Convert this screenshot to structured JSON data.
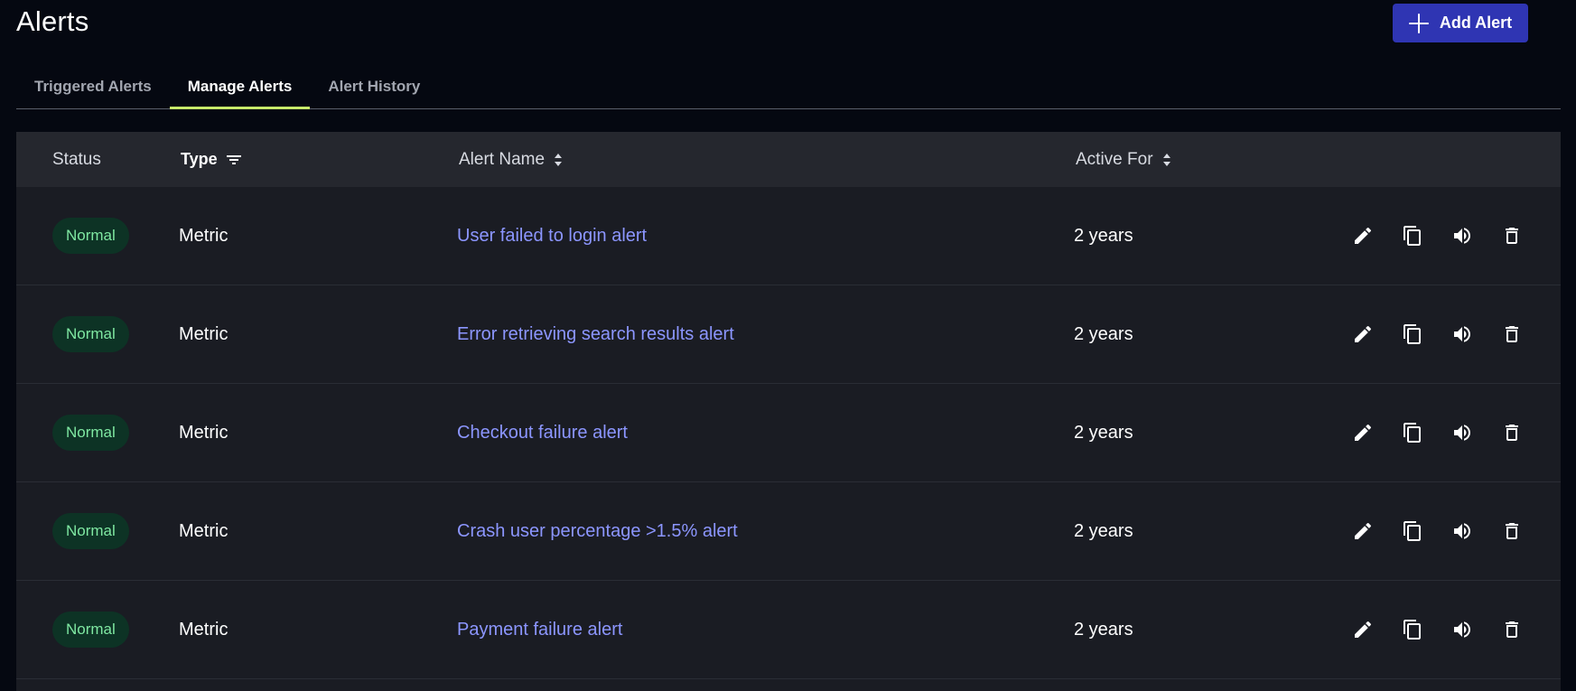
{
  "page": {
    "title": "Alerts"
  },
  "header": {
    "add_button_label": "Add Alert"
  },
  "tabs": [
    {
      "label": "Triggered Alerts",
      "active": false
    },
    {
      "label": "Manage Alerts",
      "active": true
    },
    {
      "label": "Alert History",
      "active": false
    }
  ],
  "table": {
    "columns": {
      "status": "Status",
      "type": "Type",
      "alert_name": "Alert Name",
      "active_for": "Active For"
    },
    "rows": [
      {
        "status": "Normal",
        "type": "Metric",
        "alert_name": "User failed to login alert",
        "active_for": "2 years"
      },
      {
        "status": "Normal",
        "type": "Metric",
        "alert_name": "Error retrieving search results alert",
        "active_for": "2 years"
      },
      {
        "status": "Normal",
        "type": "Metric",
        "alert_name": "Checkout failure alert",
        "active_for": "2 years"
      },
      {
        "status": "Normal",
        "type": "Metric",
        "alert_name": "Crash user percentage >1.5% alert",
        "active_for": "2 years"
      },
      {
        "status": "Normal",
        "type": "Metric",
        "alert_name": "Payment failure alert",
        "active_for": "2 years"
      }
    ],
    "row_actions": [
      "pencil-icon",
      "copy-icon",
      "volume-icon",
      "trash-icon"
    ]
  },
  "colors": {
    "background": "#050811",
    "accent_button": "#2f35b3",
    "active_tab_underline": "#c7ea6a",
    "status_badge_bg": "#0d3325",
    "status_badge_text": "#7fe8a2",
    "link": "#8c96ff"
  }
}
